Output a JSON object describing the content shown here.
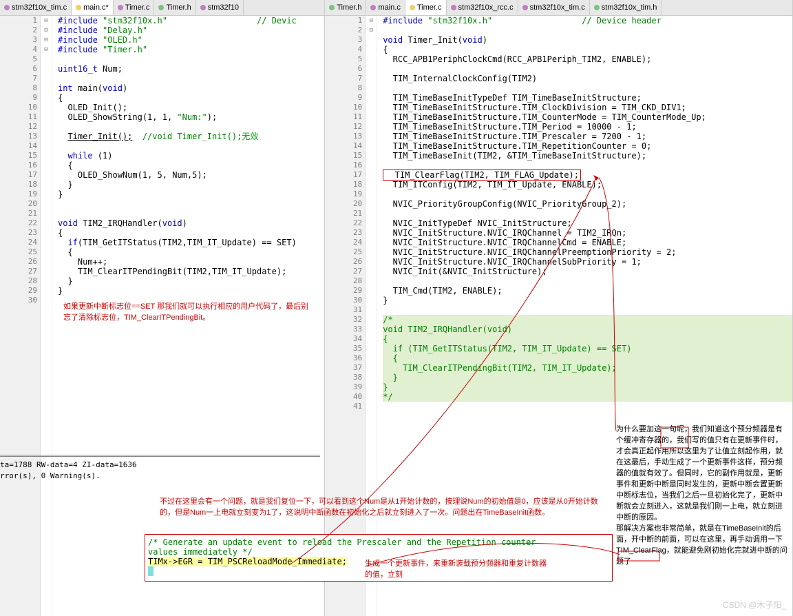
{
  "left": {
    "tabs": [
      {
        "label": "stm32f10x_tim.c",
        "icon": "cfile"
      },
      {
        "label": "main.c*",
        "icon": "yellow",
        "active": true
      },
      {
        "label": "Timer.c",
        "icon": "cfile"
      },
      {
        "label": "Timer.h",
        "icon": "hfile"
      },
      {
        "label": "stm32f10",
        "icon": "cfile"
      }
    ],
    "lines": [
      {
        "n": 1,
        "f": "",
        "c": "#include \"stm32f10x.h\"                  // Devic"
      },
      {
        "n": 2,
        "f": "",
        "c": "#include \"Delay.h\""
      },
      {
        "n": 3,
        "f": "",
        "c": "#include \"OLED.h\""
      },
      {
        "n": 4,
        "f": "",
        "c": "#include \"Timer.h\""
      },
      {
        "n": 5,
        "f": "",
        "c": ""
      },
      {
        "n": 6,
        "f": "",
        "c": "uint16_t Num;"
      },
      {
        "n": 7,
        "f": "",
        "c": ""
      },
      {
        "n": 8,
        "f": "",
        "c": "int main(void)"
      },
      {
        "n": 9,
        "f": "⊟",
        "c": "{"
      },
      {
        "n": 10,
        "f": "",
        "c": "  OLED_Init();"
      },
      {
        "n": 11,
        "f": "",
        "c": "  OLED_ShowString(1, 1, \"Num:\");"
      },
      {
        "n": 12,
        "f": "",
        "c": ""
      },
      {
        "n": 13,
        "f": "",
        "c": "  Timer_Init();  //void Timer_Init();无效"
      },
      {
        "n": 14,
        "f": "",
        "c": ""
      },
      {
        "n": 15,
        "f": "",
        "c": "  while (1)"
      },
      {
        "n": 16,
        "f": "⊟",
        "c": "  {"
      },
      {
        "n": 17,
        "f": "",
        "c": "    OLED_ShowNum(1, 5, Num,5);"
      },
      {
        "n": 18,
        "f": "",
        "c": "  }"
      },
      {
        "n": 19,
        "f": "",
        "c": "}"
      },
      {
        "n": 20,
        "f": "",
        "c": ""
      },
      {
        "n": 21,
        "f": "",
        "c": ""
      },
      {
        "n": 22,
        "f": "",
        "c": "void TIM2_IRQHandler(void)"
      },
      {
        "n": 23,
        "f": "⊟",
        "c": "{"
      },
      {
        "n": 24,
        "f": "",
        "c": "  if(TIM_GetITStatus(TIM2,TIM_IT_Update) == SET)"
      },
      {
        "n": 25,
        "f": "⊟",
        "c": "  {"
      },
      {
        "n": 26,
        "f": "",
        "c": "    Num++;"
      },
      {
        "n": 27,
        "f": "",
        "c": "    TIM_ClearITPendingBit(TIM2,TIM_IT_Update);"
      },
      {
        "n": 28,
        "f": "",
        "c": "  }"
      },
      {
        "n": 29,
        "f": "",
        "c": "}"
      },
      {
        "n": 30,
        "f": "",
        "c": ""
      }
    ],
    "ann1": "如果更新中断标志位==SET 那我们就可以执行相应的用户代码了，最后别忘了清除标志位，TIM_ClearITPendingBit。"
  },
  "right": {
    "tabs": [
      {
        "label": "Timer.h",
        "icon": "hfile"
      },
      {
        "label": "main.c",
        "icon": "cfile"
      },
      {
        "label": "Timer.c",
        "icon": "yellow",
        "active": true
      },
      {
        "label": "stm32f10x_rcc.c",
        "icon": "cfile"
      },
      {
        "label": "stm32f10x_tim.c",
        "icon": "cfile"
      },
      {
        "label": "stm32f10x_tim.h",
        "icon": "hfile"
      }
    ],
    "lines": [
      {
        "n": 1,
        "c": "#include \"stm32f10x.h\"                  // Device header"
      },
      {
        "n": 2,
        "c": ""
      },
      {
        "n": 3,
        "c": "void Timer_Init(void)"
      },
      {
        "n": 4,
        "c": "{",
        "f": "⊟"
      },
      {
        "n": 5,
        "c": "  RCC_APB1PeriphClockCmd(RCC_APB1Periph_TIM2, ENABLE);"
      },
      {
        "n": 6,
        "c": ""
      },
      {
        "n": 7,
        "c": "  TIM_InternalClockConfig(TIM2)"
      },
      {
        "n": 8,
        "c": ""
      },
      {
        "n": 9,
        "c": "  TIM_TimeBaseInitTypeDef TIM_TimeBaseInitStructure;"
      },
      {
        "n": 10,
        "c": "  TIM_TimeBaseInitStructure.TIM_ClockDivision = TIM_CKD_DIV1;"
      },
      {
        "n": 11,
        "c": "  TIM_TimeBaseInitStructure.TIM_CounterMode = TIM_CounterMode_Up;"
      },
      {
        "n": 12,
        "c": "  TIM_TimeBaseInitStructure.TIM_Period = 10000 - 1;"
      },
      {
        "n": 13,
        "c": "  TIM_TimeBaseInitStructure.TIM_Prescaler = 7200 - 1;"
      },
      {
        "n": 14,
        "c": "  TIM_TimeBaseInitStructure.TIM_RepetitionCounter = 0;"
      },
      {
        "n": 15,
        "c": "  TIM_TimeBaseInit(TIM2, &TIM_TimeBaseInitStructure);"
      },
      {
        "n": 16,
        "c": ""
      },
      {
        "n": 17,
        "c": "  TIM_ClearFlag(TIM2, TIM_FLAG_Update);",
        "box": true
      },
      {
        "n": 18,
        "c": "  TIM_ITConfig(TIM2, TIM_IT_Update, ENABLE);"
      },
      {
        "n": 19,
        "c": ""
      },
      {
        "n": 20,
        "c": "  NVIC_PriorityGroupConfig(NVIC_PriorityGroup_2);"
      },
      {
        "n": 21,
        "c": ""
      },
      {
        "n": 22,
        "c": "  NVIC_InitTypeDef NVIC_InitStructure;"
      },
      {
        "n": 23,
        "c": "  NVIC_InitStructure.NVIC_IRQChannel = TIM2_IRQn;"
      },
      {
        "n": 24,
        "c": "  NVIC_InitStructure.NVIC_IRQChannelCmd = ENABLE;"
      },
      {
        "n": 25,
        "c": "  NVIC_InitStructure.NVIC_IRQChannelPreemptionPriority = 2;"
      },
      {
        "n": 26,
        "c": "  NVIC_InitStructure.NVIC_IRQChannelSubPriority = 1;"
      },
      {
        "n": 27,
        "c": "  NVIC_Init(&NVIC_InitStructure);"
      },
      {
        "n": 28,
        "c": ""
      },
      {
        "n": 29,
        "c": "  TIM_Cmd(TIM2, ENABLE);"
      },
      {
        "n": 30,
        "c": "}"
      },
      {
        "n": 31,
        "c": ""
      },
      {
        "n": 32,
        "c": "/*",
        "f": "⊟",
        "hl": true
      },
      {
        "n": 33,
        "c": "void TIM2_IRQHandler(void)",
        "hl": true
      },
      {
        "n": 34,
        "c": "{",
        "hl": true
      },
      {
        "n": 35,
        "c": "  if (TIM_GetITStatus(TIM2, TIM_IT_Update) == SET)",
        "hl": true
      },
      {
        "n": 36,
        "c": "  {",
        "hl": true
      },
      {
        "n": 37,
        "c": "",
        "hl": true
      },
      {
        "n": 38,
        "c": "    TIM_ClearITPendingBit(TIM2, TIM_IT_Update);",
        "hl": true
      },
      {
        "n": 39,
        "c": "  }",
        "hl": true
      },
      {
        "n": 40,
        "c": "}",
        "hl": true
      },
      {
        "n": 41,
        "c": "*/",
        "hl": true
      }
    ]
  },
  "output": {
    "line1": "ta=1788 RW-data=4 ZI-data=1636",
    "line2": "rror(s), 0 Warning(s)."
  },
  "ann_red_middle": "不过在这里会有一个问题，就是我们复位一下，可以看到这个Num是从1开始计数的，按理说Num的初始值是0，应该是从0开始计数的，但是Num一上电就立刻变为1了，这说明中断函数在初始化之后就立刻进入了一次。问题出在TimeBaseInit函数。",
  "snippet": {
    "line1": "/* Generate an update event to reload the Prescaler and the Repetition counter",
    "line2": "   values immediately */",
    "line3": "TIMx->EGR = TIM_PSCReloadMode_Immediate;",
    "ann": "生成一个更新事件，来重新装载预分频器和重复计数器的值，立刻"
  },
  "ann_right_long": "为什么要加这一句呢，我们知道这个预分频器是有个缓冲寄存器的，我们写的值只有在更新事件时，才会真正起作用所以这里为了让值立刻起作用，就在这最后，手动生成了一个更新事件这样，预分频器的值就有效了。但同时，它的副作用就是，更新事件和更新中断是同时发生的，更新中断会置更新中断标志位，当我们之后一旦初始化完了，更新中断就会立刻进入，这就是我们刚一上电，就立刻进中断的原因。\n那解决方案也非常简单，就是在TimeBaseInit的后面，开中断的前面，可以在这里，再手动调用一下TIM_ClearFlag，就能避免刚初始化完就进中断的问题了",
  "watermark": "CSDN @木子阳_"
}
